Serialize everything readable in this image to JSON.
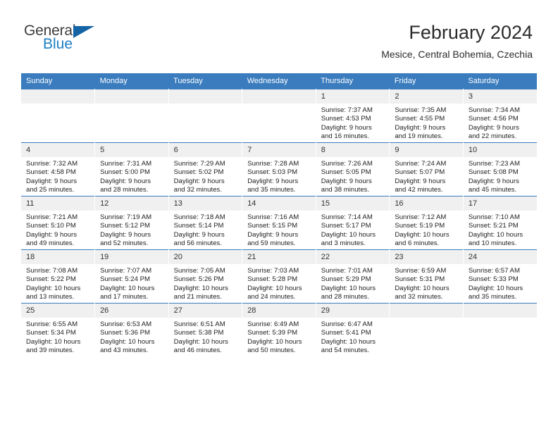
{
  "brand": {
    "name_part1": "General",
    "name_part2": "Blue"
  },
  "header": {
    "title": "February 2024",
    "subtitle": "Mesice, Central Bohemia, Czechia"
  },
  "colors": {
    "header_blue": "#3a7cbe",
    "brand_blue": "#1b7fc4",
    "daynum_band": "#f0f0f0"
  },
  "weekdays": [
    "Sunday",
    "Monday",
    "Tuesday",
    "Wednesday",
    "Thursday",
    "Friday",
    "Saturday"
  ],
  "weeks": [
    [
      {
        "day": "",
        "empty": true,
        "l1": "",
        "l2": "",
        "l3": "",
        "l4": ""
      },
      {
        "day": "",
        "empty": true,
        "l1": "",
        "l2": "",
        "l3": "",
        "l4": ""
      },
      {
        "day": "",
        "empty": true,
        "l1": "",
        "l2": "",
        "l3": "",
        "l4": ""
      },
      {
        "day": "",
        "empty": true,
        "l1": "",
        "l2": "",
        "l3": "",
        "l4": ""
      },
      {
        "day": "1",
        "l1": "Sunrise: 7:37 AM",
        "l2": "Sunset: 4:53 PM",
        "l3": "Daylight: 9 hours",
        "l4": "and 16 minutes."
      },
      {
        "day": "2",
        "l1": "Sunrise: 7:35 AM",
        "l2": "Sunset: 4:55 PM",
        "l3": "Daylight: 9 hours",
        "l4": "and 19 minutes."
      },
      {
        "day": "3",
        "l1": "Sunrise: 7:34 AM",
        "l2": "Sunset: 4:56 PM",
        "l3": "Daylight: 9 hours",
        "l4": "and 22 minutes."
      }
    ],
    [
      {
        "day": "4",
        "l1": "Sunrise: 7:32 AM",
        "l2": "Sunset: 4:58 PM",
        "l3": "Daylight: 9 hours",
        "l4": "and 25 minutes."
      },
      {
        "day": "5",
        "l1": "Sunrise: 7:31 AM",
        "l2": "Sunset: 5:00 PM",
        "l3": "Daylight: 9 hours",
        "l4": "and 28 minutes."
      },
      {
        "day": "6",
        "l1": "Sunrise: 7:29 AM",
        "l2": "Sunset: 5:02 PM",
        "l3": "Daylight: 9 hours",
        "l4": "and 32 minutes."
      },
      {
        "day": "7",
        "l1": "Sunrise: 7:28 AM",
        "l2": "Sunset: 5:03 PM",
        "l3": "Daylight: 9 hours",
        "l4": "and 35 minutes."
      },
      {
        "day": "8",
        "l1": "Sunrise: 7:26 AM",
        "l2": "Sunset: 5:05 PM",
        "l3": "Daylight: 9 hours",
        "l4": "and 38 minutes."
      },
      {
        "day": "9",
        "l1": "Sunrise: 7:24 AM",
        "l2": "Sunset: 5:07 PM",
        "l3": "Daylight: 9 hours",
        "l4": "and 42 minutes."
      },
      {
        "day": "10",
        "l1": "Sunrise: 7:23 AM",
        "l2": "Sunset: 5:08 PM",
        "l3": "Daylight: 9 hours",
        "l4": "and 45 minutes."
      }
    ],
    [
      {
        "day": "11",
        "l1": "Sunrise: 7:21 AM",
        "l2": "Sunset: 5:10 PM",
        "l3": "Daylight: 9 hours",
        "l4": "and 49 minutes."
      },
      {
        "day": "12",
        "l1": "Sunrise: 7:19 AM",
        "l2": "Sunset: 5:12 PM",
        "l3": "Daylight: 9 hours",
        "l4": "and 52 minutes."
      },
      {
        "day": "13",
        "l1": "Sunrise: 7:18 AM",
        "l2": "Sunset: 5:14 PM",
        "l3": "Daylight: 9 hours",
        "l4": "and 56 minutes."
      },
      {
        "day": "14",
        "l1": "Sunrise: 7:16 AM",
        "l2": "Sunset: 5:15 PM",
        "l3": "Daylight: 9 hours",
        "l4": "and 59 minutes."
      },
      {
        "day": "15",
        "l1": "Sunrise: 7:14 AM",
        "l2": "Sunset: 5:17 PM",
        "l3": "Daylight: 10 hours",
        "l4": "and 3 minutes."
      },
      {
        "day": "16",
        "l1": "Sunrise: 7:12 AM",
        "l2": "Sunset: 5:19 PM",
        "l3": "Daylight: 10 hours",
        "l4": "and 6 minutes."
      },
      {
        "day": "17",
        "l1": "Sunrise: 7:10 AM",
        "l2": "Sunset: 5:21 PM",
        "l3": "Daylight: 10 hours",
        "l4": "and 10 minutes."
      }
    ],
    [
      {
        "day": "18",
        "l1": "Sunrise: 7:08 AM",
        "l2": "Sunset: 5:22 PM",
        "l3": "Daylight: 10 hours",
        "l4": "and 13 minutes."
      },
      {
        "day": "19",
        "l1": "Sunrise: 7:07 AM",
        "l2": "Sunset: 5:24 PM",
        "l3": "Daylight: 10 hours",
        "l4": "and 17 minutes."
      },
      {
        "day": "20",
        "l1": "Sunrise: 7:05 AM",
        "l2": "Sunset: 5:26 PM",
        "l3": "Daylight: 10 hours",
        "l4": "and 21 minutes."
      },
      {
        "day": "21",
        "l1": "Sunrise: 7:03 AM",
        "l2": "Sunset: 5:28 PM",
        "l3": "Daylight: 10 hours",
        "l4": "and 24 minutes."
      },
      {
        "day": "22",
        "l1": "Sunrise: 7:01 AM",
        "l2": "Sunset: 5:29 PM",
        "l3": "Daylight: 10 hours",
        "l4": "and 28 minutes."
      },
      {
        "day": "23",
        "l1": "Sunrise: 6:59 AM",
        "l2": "Sunset: 5:31 PM",
        "l3": "Daylight: 10 hours",
        "l4": "and 32 minutes."
      },
      {
        "day": "24",
        "l1": "Sunrise: 6:57 AM",
        "l2": "Sunset: 5:33 PM",
        "l3": "Daylight: 10 hours",
        "l4": "and 35 minutes."
      }
    ],
    [
      {
        "day": "25",
        "l1": "Sunrise: 6:55 AM",
        "l2": "Sunset: 5:34 PM",
        "l3": "Daylight: 10 hours",
        "l4": "and 39 minutes."
      },
      {
        "day": "26",
        "l1": "Sunrise: 6:53 AM",
        "l2": "Sunset: 5:36 PM",
        "l3": "Daylight: 10 hours",
        "l4": "and 43 minutes."
      },
      {
        "day": "27",
        "l1": "Sunrise: 6:51 AM",
        "l2": "Sunset: 5:38 PM",
        "l3": "Daylight: 10 hours",
        "l4": "and 46 minutes."
      },
      {
        "day": "28",
        "l1": "Sunrise: 6:49 AM",
        "l2": "Sunset: 5:39 PM",
        "l3": "Daylight: 10 hours",
        "l4": "and 50 minutes."
      },
      {
        "day": "29",
        "l1": "Sunrise: 6:47 AM",
        "l2": "Sunset: 5:41 PM",
        "l3": "Daylight: 10 hours",
        "l4": "and 54 minutes."
      },
      {
        "day": "",
        "empty": true,
        "l1": "",
        "l2": "",
        "l3": "",
        "l4": ""
      },
      {
        "day": "",
        "empty": true,
        "l1": "",
        "l2": "",
        "l3": "",
        "l4": ""
      }
    ]
  ]
}
